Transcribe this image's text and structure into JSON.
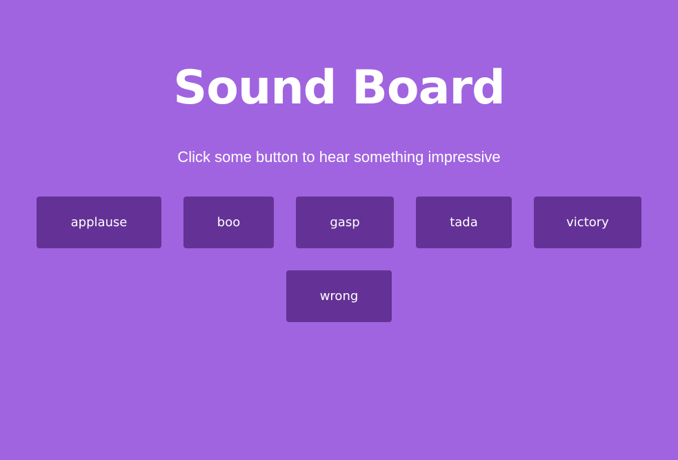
{
  "header": {
    "title": "Sound Board",
    "subtitle": "Click some button to hear something impressive"
  },
  "buttons": [
    {
      "label": "applause"
    },
    {
      "label": "boo"
    },
    {
      "label": "gasp"
    },
    {
      "label": "tada"
    },
    {
      "label": "victory"
    },
    {
      "label": "wrong"
    }
  ],
  "colors": {
    "background": "#a064e0",
    "button": "#643296",
    "text": "#ffffff"
  }
}
